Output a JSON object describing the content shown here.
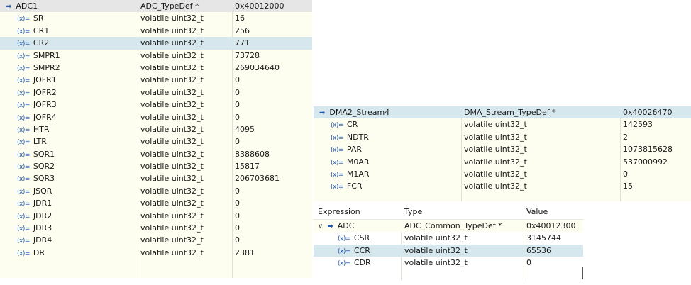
{
  "adc1": {
    "root": {
      "name": "ADC1",
      "type": "ADC_TypeDef *",
      "value": "0x40012000"
    },
    "rows": [
      {
        "name": "SR",
        "type": "volatile uint32_t",
        "value": "16"
      },
      {
        "name": "CR1",
        "type": "volatile uint32_t",
        "value": "256"
      },
      {
        "name": "CR2",
        "type": "volatile uint32_t",
        "value": "771"
      },
      {
        "name": "SMPR1",
        "type": "volatile uint32_t",
        "value": "73728"
      },
      {
        "name": "SMPR2",
        "type": "volatile uint32_t",
        "value": "269034640"
      },
      {
        "name": "JOFR1",
        "type": "volatile uint32_t",
        "value": "0"
      },
      {
        "name": "JOFR2",
        "type": "volatile uint32_t",
        "value": "0"
      },
      {
        "name": "JOFR3",
        "type": "volatile uint32_t",
        "value": "0"
      },
      {
        "name": "JOFR4",
        "type": "volatile uint32_t",
        "value": "0"
      },
      {
        "name": "HTR",
        "type": "volatile uint32_t",
        "value": "4095"
      },
      {
        "name": "LTR",
        "type": "volatile uint32_t",
        "value": "0"
      },
      {
        "name": "SQR1",
        "type": "volatile uint32_t",
        "value": "8388608"
      },
      {
        "name": "SQR2",
        "type": "volatile uint32_t",
        "value": "15817"
      },
      {
        "name": "SQR3",
        "type": "volatile uint32_t",
        "value": "206703681"
      },
      {
        "name": "JSQR",
        "type": "volatile uint32_t",
        "value": "0"
      },
      {
        "name": "JDR1",
        "type": "volatile uint32_t",
        "value": "0"
      },
      {
        "name": "JDR2",
        "type": "volatile uint32_t",
        "value": "0"
      },
      {
        "name": "JDR3",
        "type": "volatile uint32_t",
        "value": "0"
      },
      {
        "name": "JDR4",
        "type": "volatile uint32_t",
        "value": "0"
      },
      {
        "name": "DR",
        "type": "volatile uint32_t",
        "value": "2381"
      }
    ]
  },
  "dma": {
    "root": {
      "name": "DMA2_Stream4",
      "type": "DMA_Stream_TypeDef *",
      "value": "0x40026470"
    },
    "rows": [
      {
        "name": "CR",
        "type": "volatile uint32_t",
        "value": "142593"
      },
      {
        "name": "NDTR",
        "type": "volatile uint32_t",
        "value": "2"
      },
      {
        "name": "PAR",
        "type": "volatile uint32_t",
        "value": "1073815628"
      },
      {
        "name": "M0AR",
        "type": "volatile uint32_t",
        "value": "537000992"
      },
      {
        "name": "M1AR",
        "type": "volatile uint32_t",
        "value": "0"
      },
      {
        "name": "FCR",
        "type": "volatile uint32_t",
        "value": "15"
      }
    ]
  },
  "expr": {
    "headers": {
      "expression": "Expression",
      "type": "Type",
      "value": "Value"
    },
    "root": {
      "name": "ADC",
      "type": "ADC_Common_TypeDef *",
      "value": "0x40012300"
    },
    "rows": [
      {
        "name": "CSR",
        "type": "volatile uint32_t",
        "value": "3145744"
      },
      {
        "name": "CCR",
        "type": "volatile uint32_t",
        "value": "65536"
      },
      {
        "name": "CDR",
        "type": "volatile uint32_t",
        "value": "0"
      }
    ]
  },
  "icons": {
    "pointer": "➡",
    "variable": "(x)=",
    "chevron": "∨"
  }
}
